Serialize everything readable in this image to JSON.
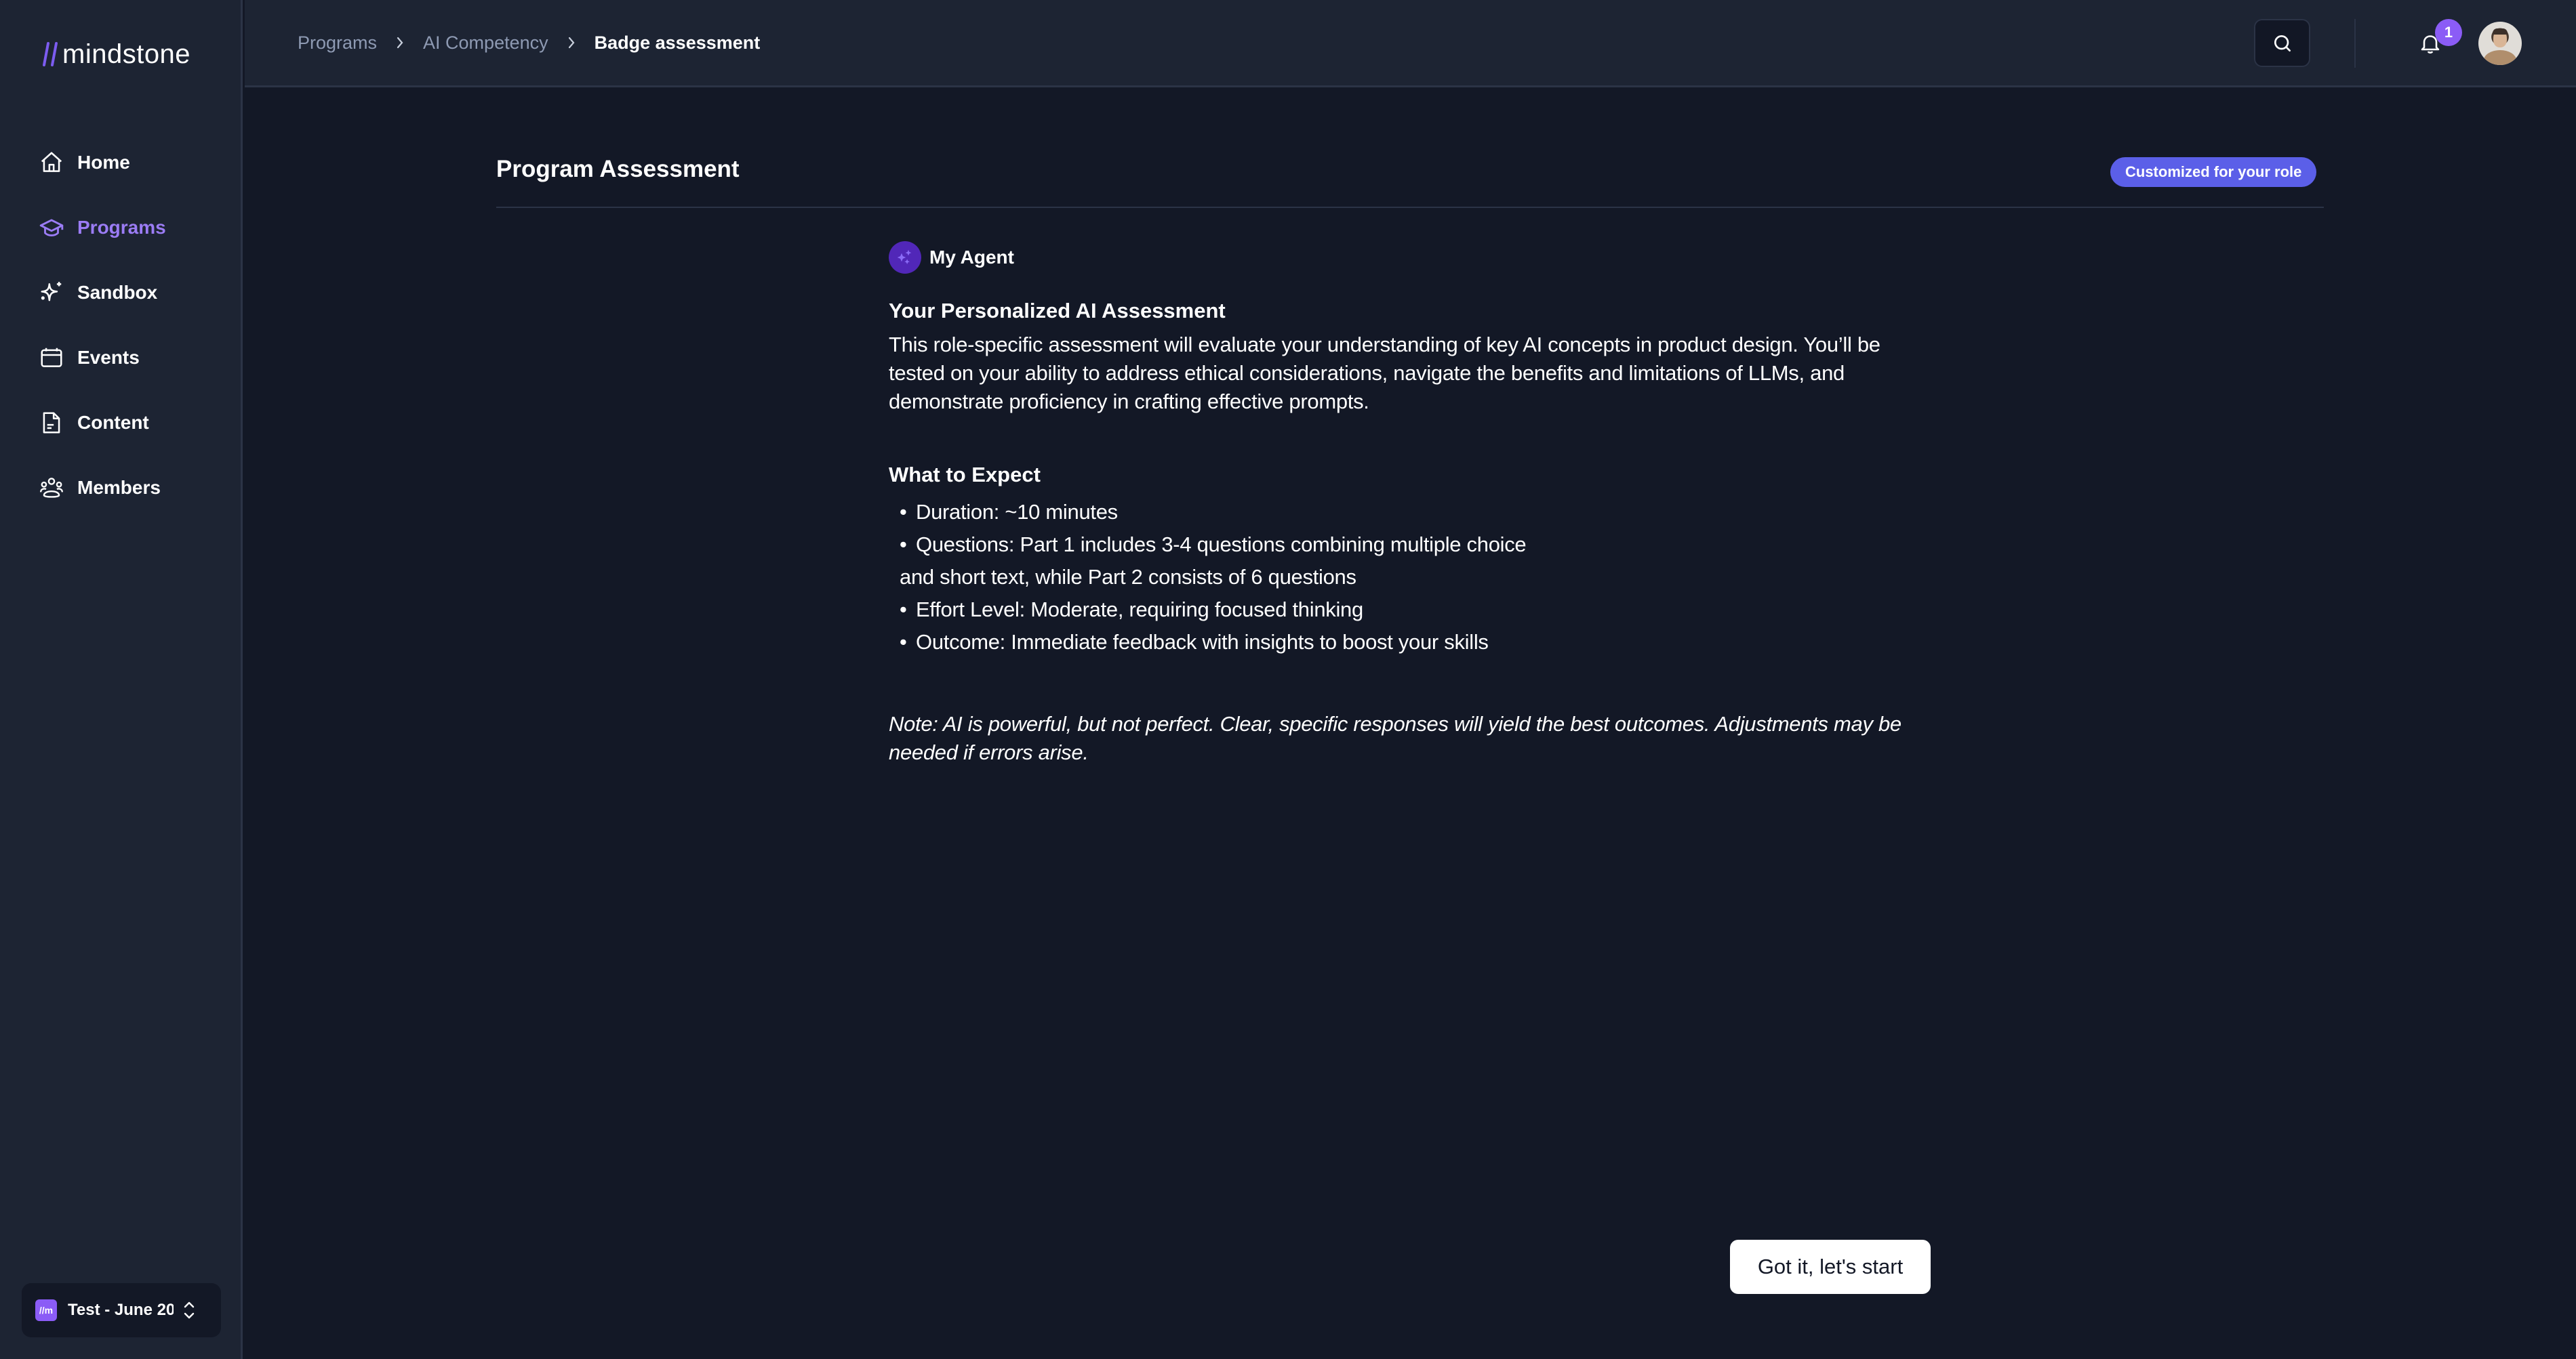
{
  "app": {
    "logo_text": "mindstone",
    "brand_color": "#8b5cf6"
  },
  "sidebar": {
    "items": [
      {
        "label": "Home",
        "icon": "home-icon",
        "active": false
      },
      {
        "label": "Programs",
        "icon": "graduation-cap-icon",
        "active": true
      },
      {
        "label": "Sandbox",
        "icon": "sparkles-icon",
        "active": false
      },
      {
        "label": "Events",
        "icon": "calendar-icon",
        "active": false
      },
      {
        "label": "Content",
        "icon": "document-icon",
        "active": false
      },
      {
        "label": "Members",
        "icon": "users-icon",
        "active": false
      }
    ],
    "workspace": {
      "logo_text": "//m",
      "name": "Test - June 20"
    }
  },
  "header": {
    "breadcrumb": [
      "Programs",
      "AI Competency",
      "Badge assessment"
    ],
    "notification_count": "1"
  },
  "main": {
    "title": "Program Assessment",
    "badge": "Customized for your role",
    "agent_name": "My Agent",
    "assessment_heading": "Your Personalized AI Assessment",
    "assessment_text": "This role-specific assessment will evaluate your understanding of key AI concepts in product design. You’ll be tested on your ability to address ethical considerations, navigate the benefits and limitations of LLMs, and demonstrate proficiency in crafting effective prompts.",
    "expect_heading": "What to Expect",
    "expect_items": [
      "Duration: ~10 minutes",
      "Questions: Part 1 includes 3-4 questions combining multiple choice",
      "and short text, while Part 2 consists of 6 questions",
      "Effort Level: Moderate, requiring focused thinking",
      "Outcome: Immediate feedback with insights to boost your skills"
    ],
    "note": "Note: AI is powerful, but not perfect. Clear, specific responses will yield the best outcomes. Adjustments may be needed if errors arise.",
    "start_button": "Got it, let's start"
  }
}
